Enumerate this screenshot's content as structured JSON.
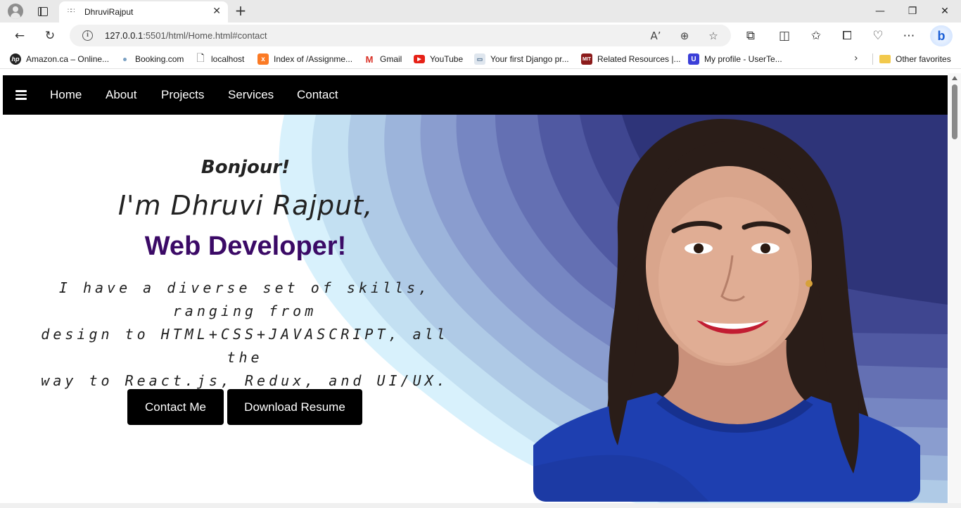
{
  "browser": {
    "tab_title": "DhruviRajput",
    "url_host": "127.0.0.1",
    "url_rest": ":5501/html/Home.html#contact",
    "bookmarks": [
      {
        "label": "Amazon.ca – Online...",
        "icon": "hp-icon"
      },
      {
        "label": "Booking.com",
        "icon": "booking-icon"
      },
      {
        "label": "localhost",
        "icon": "page-icon"
      },
      {
        "label": "Index of /Assignme...",
        "icon": "xampp-icon"
      },
      {
        "label": "Gmail",
        "icon": "gmail-icon"
      },
      {
        "label": "YouTube",
        "icon": "youtube-icon"
      },
      {
        "label": "Your first Django pr...",
        "icon": "book-icon"
      },
      {
        "label": "Related Resources |...",
        "icon": "mit-icon"
      },
      {
        "label": "My profile - UserTe...",
        "icon": "usertesting-icon"
      }
    ],
    "other_favorites": "Other favorites"
  },
  "nav": {
    "links": [
      "Home",
      "About",
      "Projects",
      "Services",
      "Contact"
    ]
  },
  "hero": {
    "greeting": "Bonjour!",
    "intro": "I'm Dhruvi Rajput,",
    "role": "Web Developer!",
    "bio_lines": [
      "I have a diverse set of skills, ranging from",
      "design to HTML+CSS+JAVASCRIPT, all the",
      "way to React.js, Redux, and UI/UX."
    ],
    "contact_button": "Contact Me",
    "resume_button": "Download Resume"
  },
  "colors": {
    "role_text": "#3b0a66",
    "nav_bg": "#000000",
    "wave_dark": "#2c3275",
    "wave_light": "#d8f1fc"
  }
}
